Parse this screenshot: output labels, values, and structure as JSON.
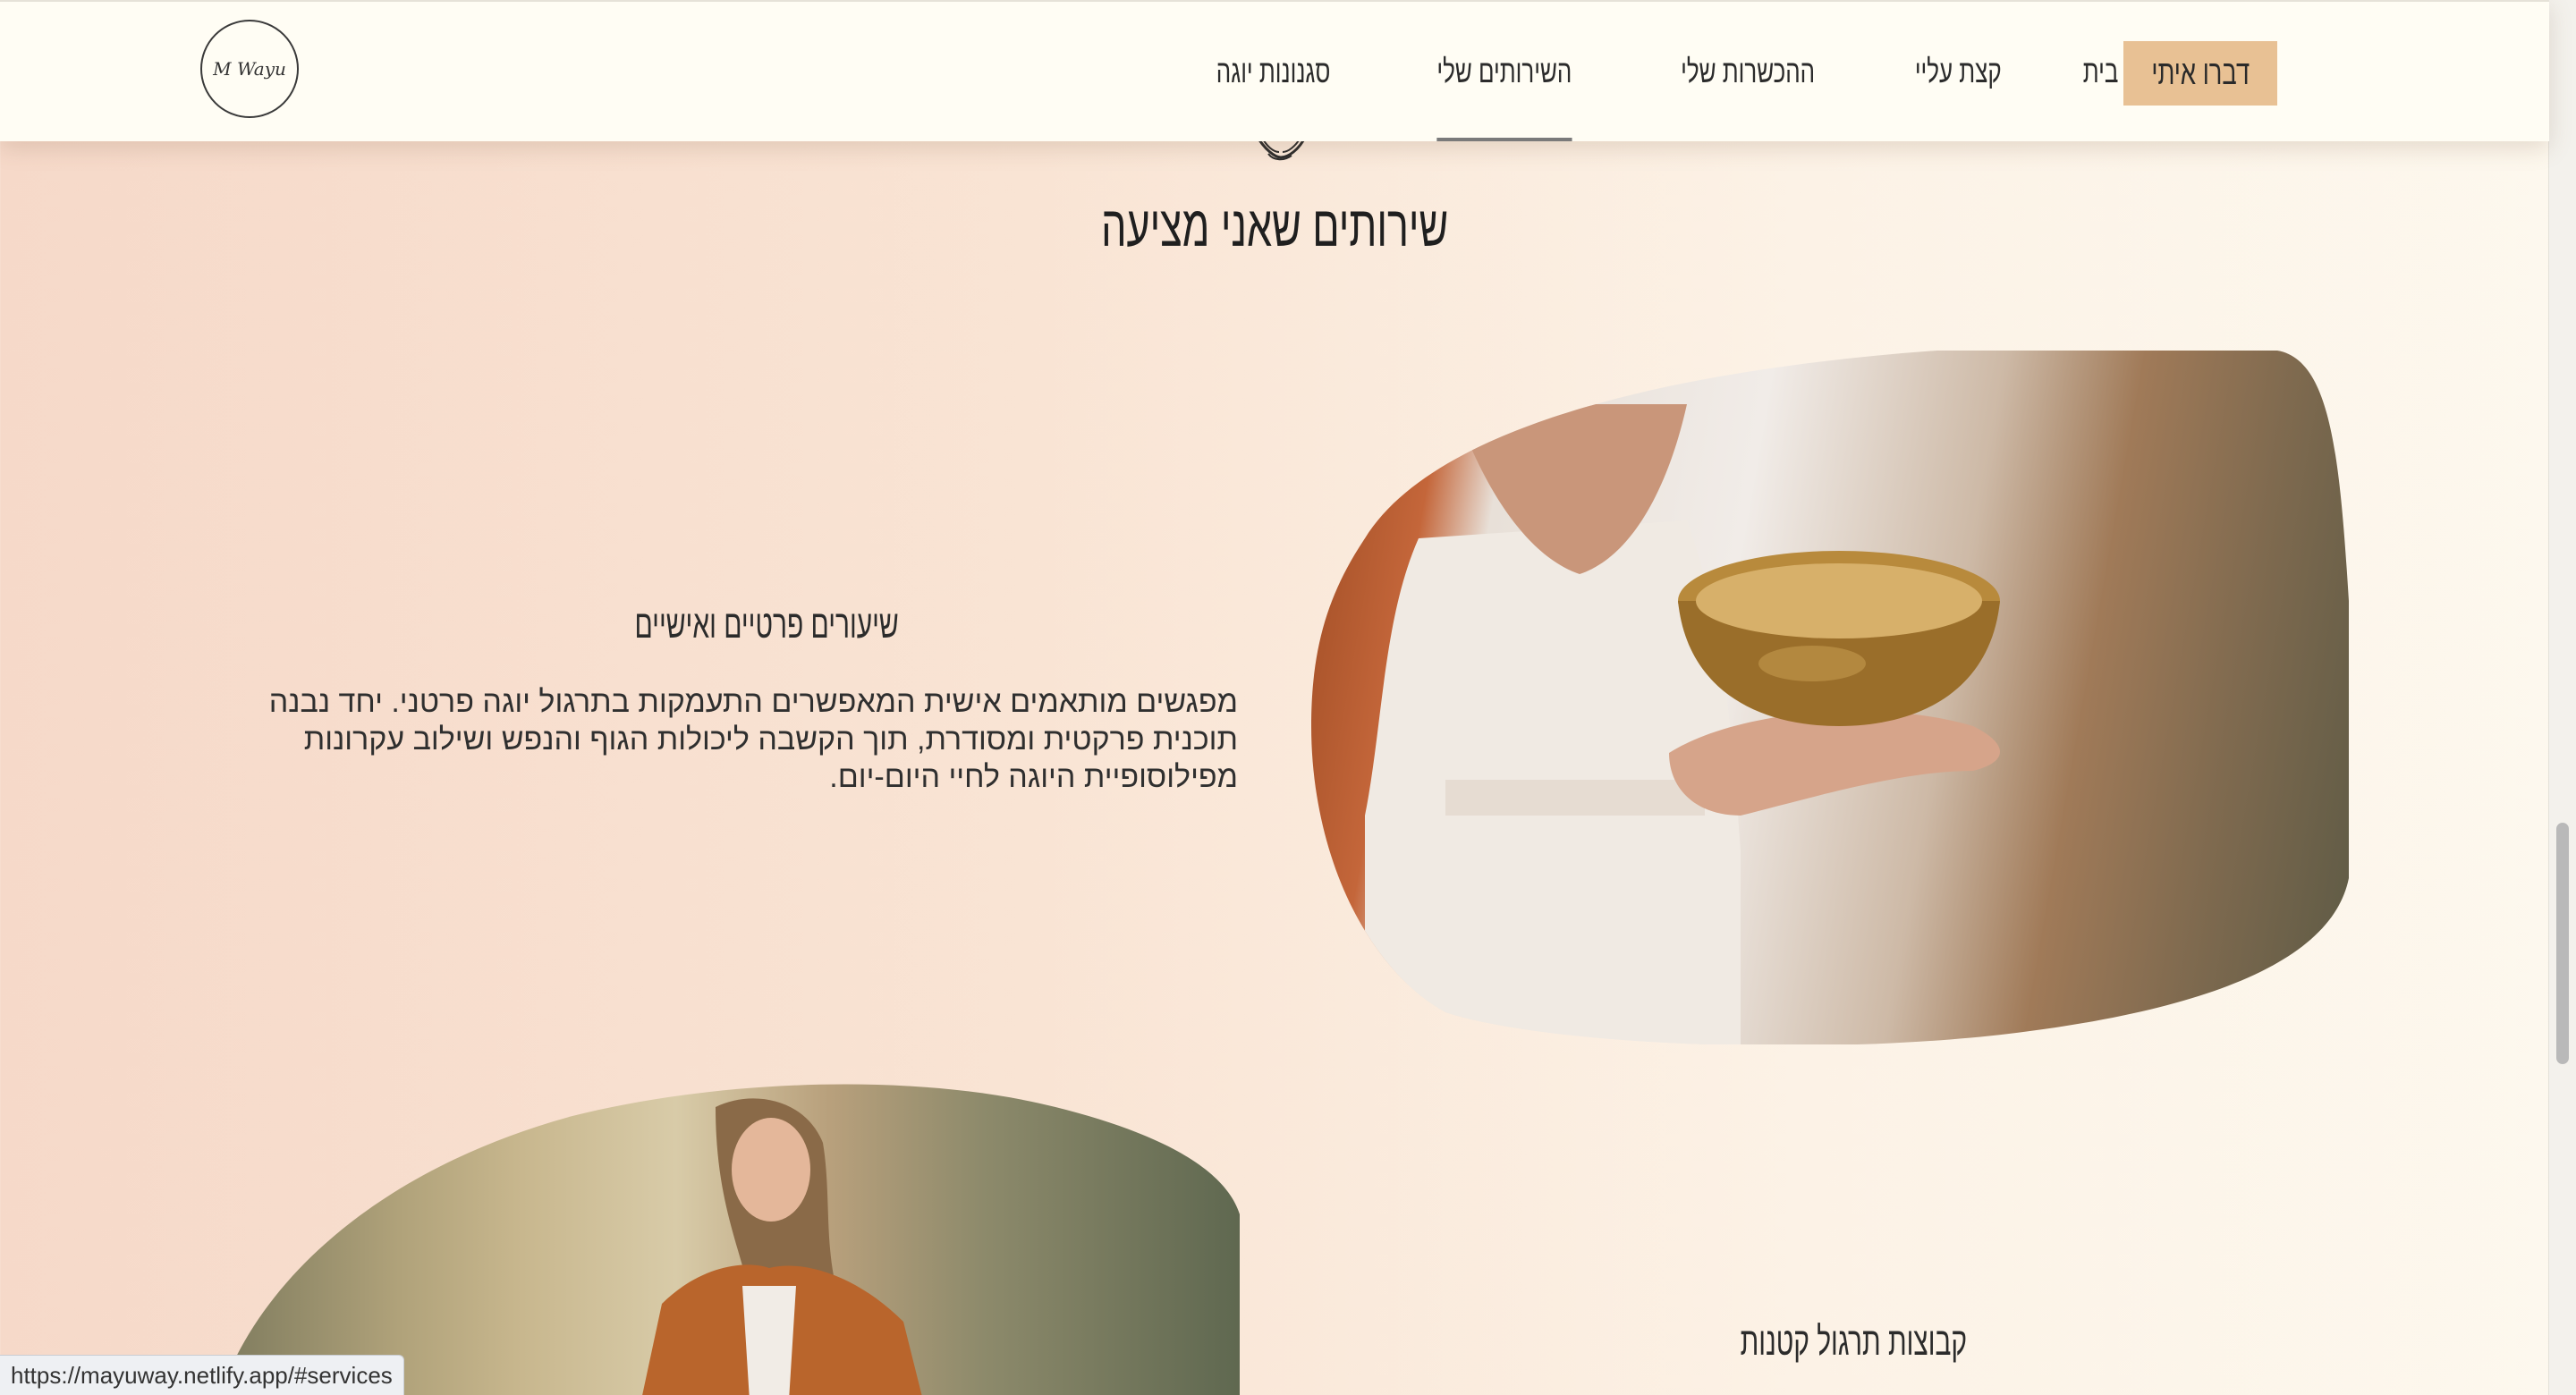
{
  "header": {
    "logo_text": "M Wayu",
    "nav": [
      {
        "label": "בית",
        "active": false
      },
      {
        "label": "קצת עליי",
        "active": false
      },
      {
        "label": "ההכשרות שלי",
        "active": false
      },
      {
        "label": "השירותים שלי",
        "active": true
      },
      {
        "label": "סגנונות יוגה",
        "active": false
      }
    ],
    "cta_label": "דברו איתי"
  },
  "section": {
    "title": "שירותים שאני מציעה",
    "services": [
      {
        "heading": "שיעורים פרטיים ואישיים",
        "description": "מפגשים מותאמים אישית המאפשרים התעמקות בתרגול יוגה פרטני. יחד נבנה תוכנית פרקטית ומסודרת, תוך הקשבה ליכולות הגוף והנפש ושילוב עקרונות מפילוסופיית היוגה לחיי היום-יום."
      },
      {
        "heading": "קבוצות תרגול קטנות"
      }
    ]
  },
  "status_bar": {
    "url": "https://mayuway.netlify.app/#services"
  },
  "colors": {
    "header_bg": "#fffdf4",
    "cta_bg": "#e8c194",
    "page_gradient_start": "#f6d9c9",
    "page_gradient_end": "#fdf8ee"
  }
}
